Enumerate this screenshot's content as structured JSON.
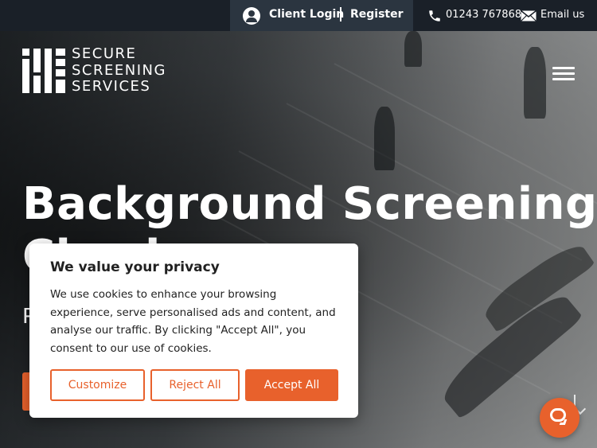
{
  "topbar": {
    "client_login": "Client Login",
    "register": "Register",
    "phone": "01243 767868",
    "email": "Email us",
    "icons": [
      "user-icon",
      "phone-icon",
      "mail-icon"
    ]
  },
  "header": {
    "logo_lines": [
      "SECURE",
      "SCREENING",
      "SERVICES"
    ],
    "menu_icon": "hamburger-menu-icon"
  },
  "hero": {
    "headline_line1": "Background Screening",
    "headline_line2": "Checks",
    "subline_peek": "P"
  },
  "cookie_banner": {
    "title": "We value your privacy",
    "body": "We use cookies to enhance your browsing experience, serve personalised ads and content, and analyse our traffic. By clicking \"Accept All\", you consent to our use of cookies.",
    "customize_label": "Customize",
    "reject_label": "Reject All",
    "accept_label": "Accept All"
  },
  "colors": {
    "accent": "#e8612c",
    "topbar": "#1a2028",
    "login_box": "#2b3540"
  },
  "chat": {
    "icon": "chat-bubble-icon"
  }
}
